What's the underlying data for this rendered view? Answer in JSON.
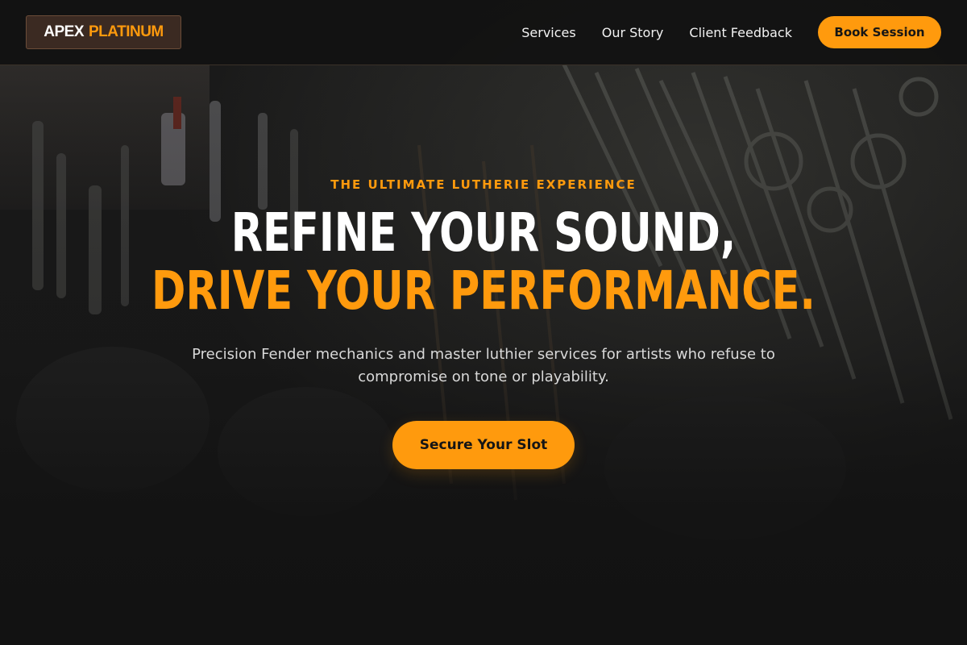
{
  "brand": {
    "word_primary": "APEX",
    "word_accent": "PLATINUM"
  },
  "nav": {
    "items": [
      {
        "label": "Services"
      },
      {
        "label": "Our Story"
      },
      {
        "label": "Client Feedback"
      }
    ],
    "cta_label": "Book Session"
  },
  "hero": {
    "eyebrow": "THE ULTIMATE LUTHERIE EXPERIENCE",
    "headline_line1": "REFINE YOUR SOUND,",
    "headline_line2": "DRIVE YOUR PERFORMANCE.",
    "subtitle": "Precision Fender mechanics and master luthier services for artists who refuse to compromise on tone or playability.",
    "cta_label": "Secure Your Slot"
  },
  "colors": {
    "accent": "#ff9a0d",
    "background": "#131313",
    "logo_background": "#3b2a22",
    "text_primary": "#ffffff"
  }
}
